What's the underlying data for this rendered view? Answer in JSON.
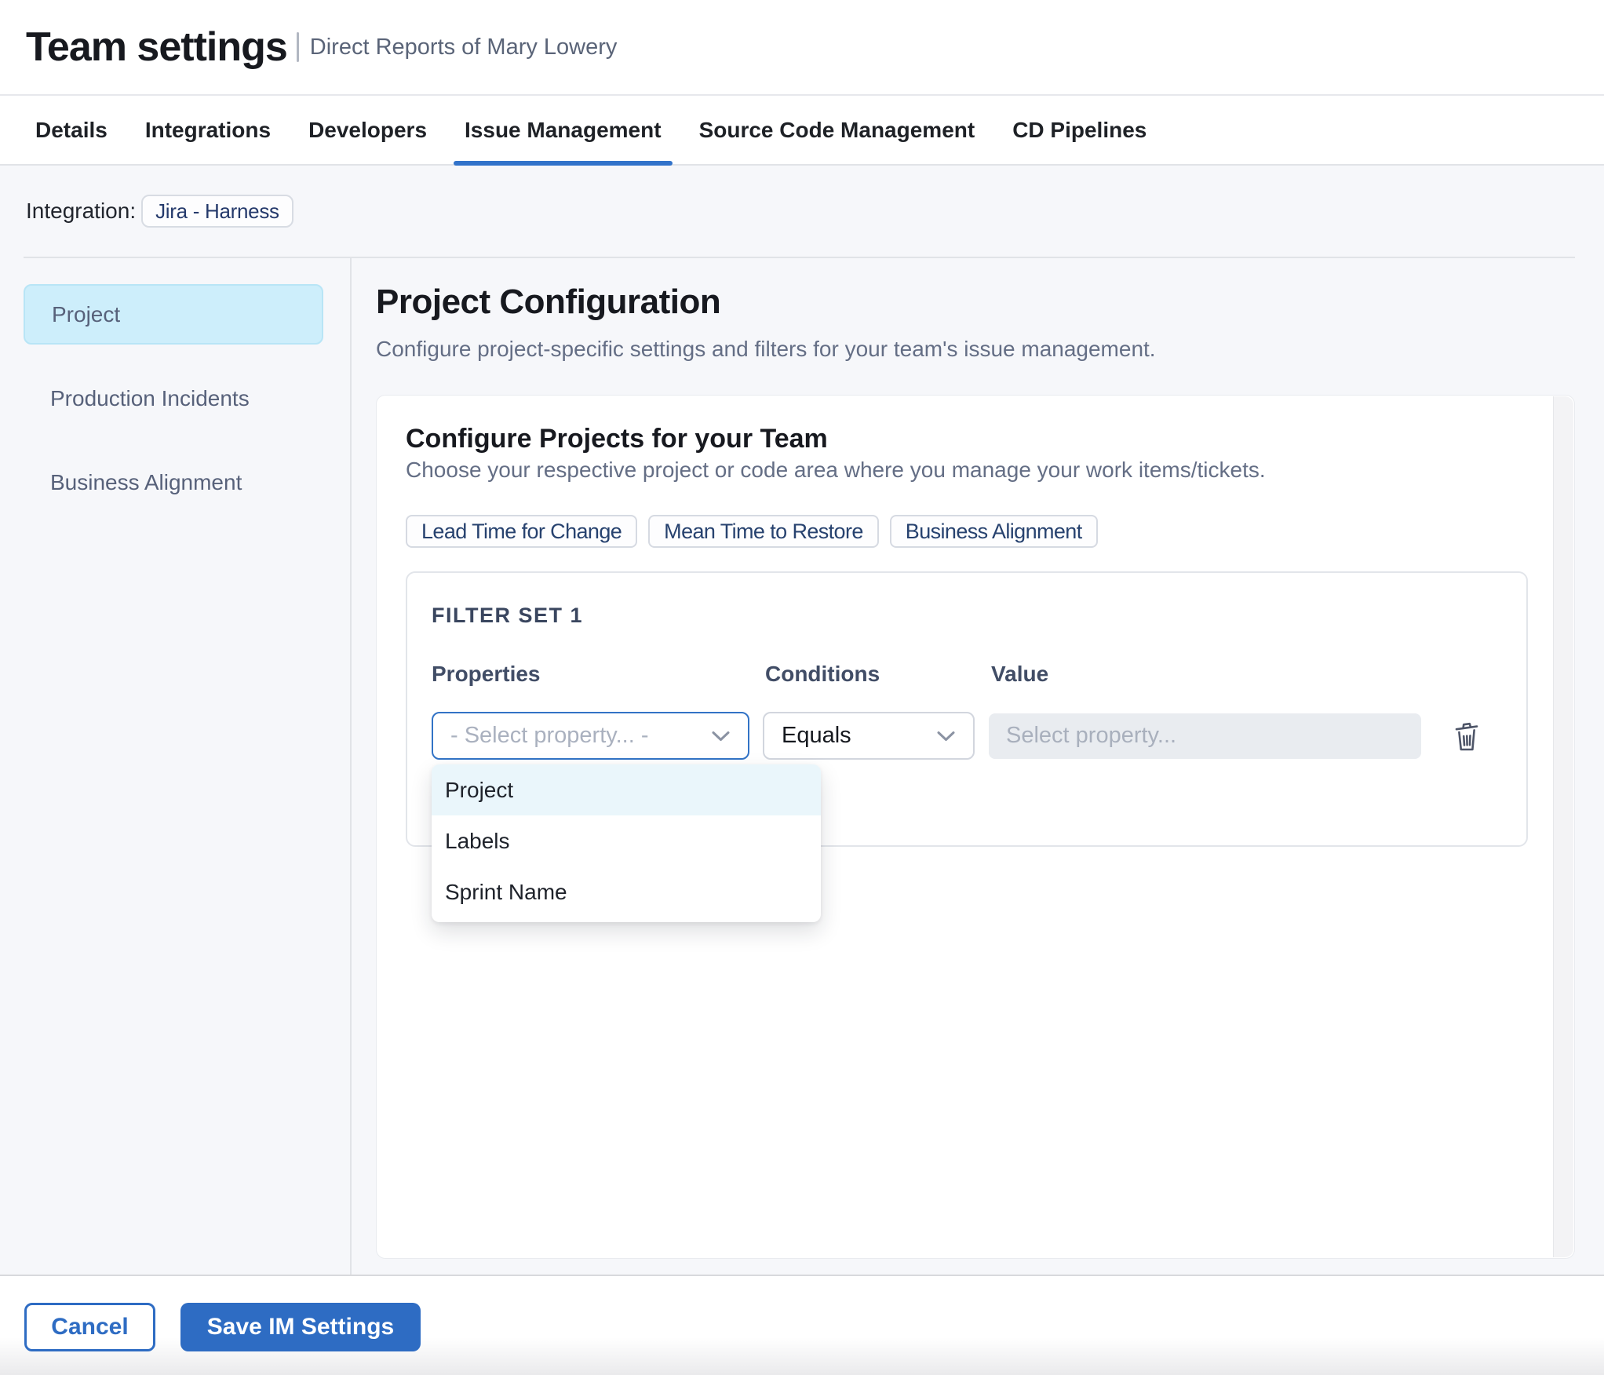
{
  "header": {
    "title": "Team settings",
    "subtitle": "Direct Reports of Mary Lowery"
  },
  "tabs": {
    "items": [
      {
        "label": "Details",
        "active": false
      },
      {
        "label": "Integrations",
        "active": false
      },
      {
        "label": "Developers",
        "active": false
      },
      {
        "label": "Issue Management",
        "active": true
      },
      {
        "label": "Source Code Management",
        "active": false
      },
      {
        "label": "CD Pipelines",
        "active": false
      }
    ]
  },
  "integration": {
    "label": "Integration:",
    "value": "Jira - Harness"
  },
  "sidebar": {
    "items": [
      {
        "label": "Project",
        "selected": true
      },
      {
        "label": "Production Incidents",
        "selected": false
      },
      {
        "label": "Business Alignment",
        "selected": false
      }
    ]
  },
  "main": {
    "title": "Project Configuration",
    "subtitle": "Configure project-specific settings and filters for your team's issue management.",
    "card": {
      "title": "Configure Projects for your Team",
      "subtitle": "Choose your respective project or code area where you manage your work items/tickets.",
      "chips": [
        {
          "label": "Lead Time for Change"
        },
        {
          "label": "Mean Time to Restore"
        },
        {
          "label": "Business Alignment"
        }
      ],
      "filter_set": {
        "title": "FILTER SET 1",
        "columns": {
          "properties": "Properties",
          "conditions": "Conditions",
          "value": "Value"
        },
        "property_placeholder": "- Select property... -",
        "condition_value": "Equals",
        "value_placeholder": "Select property...",
        "dropdown": {
          "options": [
            {
              "label": "Project",
              "highlighted": true
            },
            {
              "label": "Labels",
              "highlighted": false
            },
            {
              "label": "Sprint Name",
              "highlighted": false
            }
          ]
        }
      }
    }
  },
  "footer": {
    "cancel_label": "Cancel",
    "save_label": "Save IM Settings"
  },
  "colors": {
    "accent_blue": "#2e6cc3",
    "tab_underline": "#3273ca",
    "selected_item_bg": "#cdeefb",
    "menu_highlight": "#eaf6fb",
    "page_bg": "#f6f7fa"
  }
}
